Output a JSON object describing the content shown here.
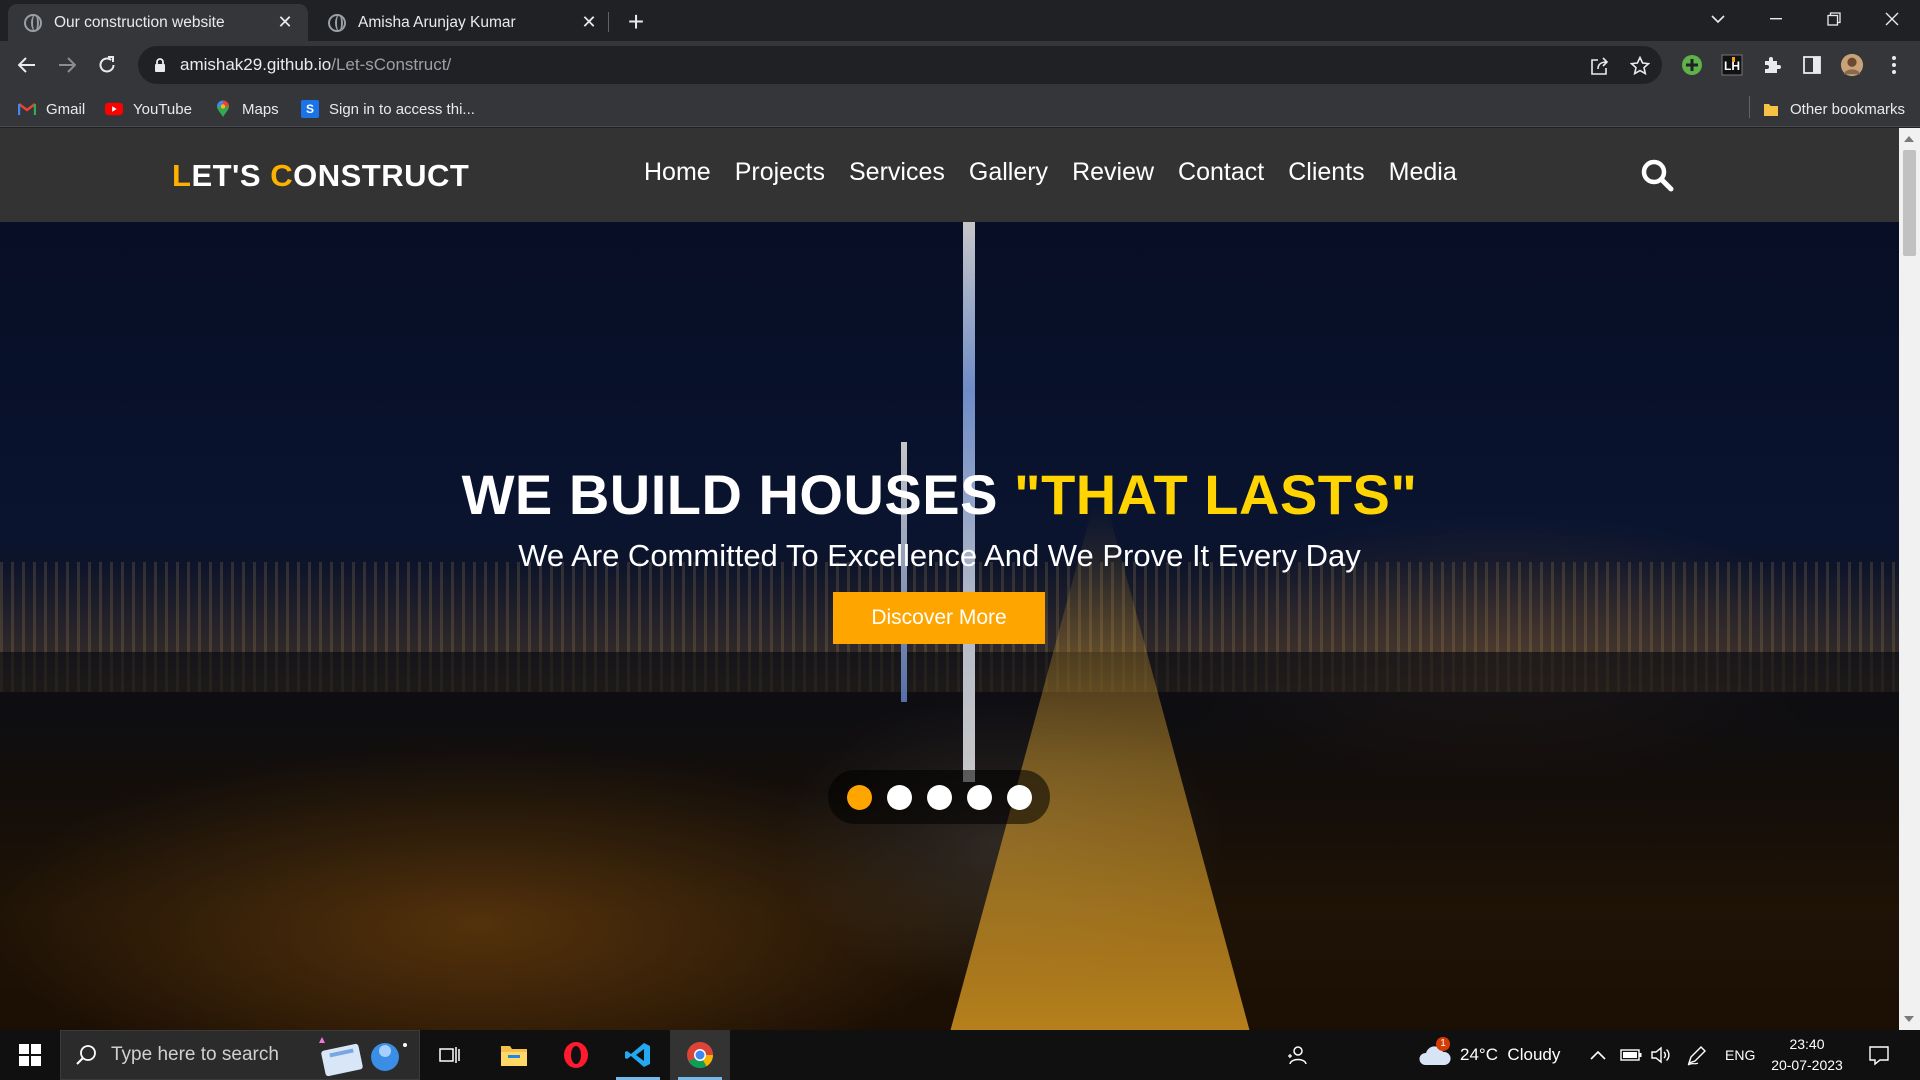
{
  "browser": {
    "tabs": [
      {
        "title": "Our construction website",
        "active": true
      },
      {
        "title": "Amisha Arunjay Kumar",
        "active": false
      }
    ],
    "url_host": "amishak29.github.io",
    "url_path": "/Let-sConstruct/",
    "bookmarks": [
      {
        "label": "Gmail",
        "icon": "gmail-icon"
      },
      {
        "label": "YouTube",
        "icon": "youtube-icon"
      },
      {
        "label": "Maps",
        "icon": "maps-icon"
      },
      {
        "label": "Sign in to access thi...",
        "icon": "s-icon"
      }
    ],
    "other_bookmarks": "Other bookmarks"
  },
  "site": {
    "logo_first_letter": "L",
    "logo_mid": "ET'S ",
    "logo_second_letter": "C",
    "logo_rest": "ONSTRUCT",
    "nav": [
      "Home",
      "Projects",
      "Services",
      "Gallery",
      "Review",
      "Contact",
      "Clients",
      "Media"
    ],
    "hero": {
      "title_main": "WE BUILD HOUSES ",
      "title_accent": "\"THAT LASTS\"",
      "subtitle": "We Are Committed To Excellence And We Prove It Every Day",
      "cta": "Discover More"
    },
    "slider": {
      "count": 5,
      "active_index": 0
    }
  },
  "taskbar": {
    "search_placeholder": "Type here to search",
    "weather": "24°C  Cloudy",
    "weather_badge": "1",
    "language": "ENG",
    "time": "23:40",
    "date": "20-07-2023"
  },
  "colors": {
    "accent": "#ffa500",
    "title_accent": "#ffd400",
    "header_bg": "#333333"
  }
}
